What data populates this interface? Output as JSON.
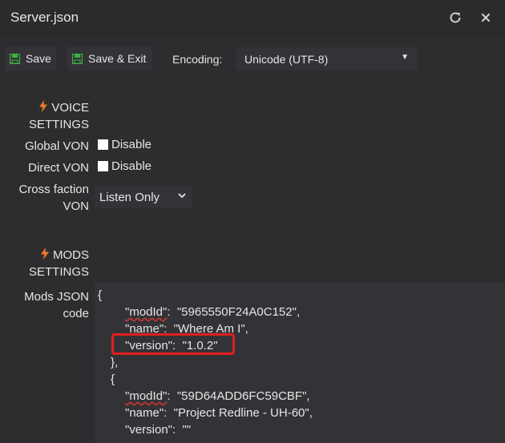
{
  "window": {
    "title": "Server.json"
  },
  "toolbar": {
    "save_label": "Save",
    "save_exit_label": "Save & Exit",
    "encoding_label": "Encoding:",
    "encoding_value": "Unicode (UTF-8)"
  },
  "voice": {
    "section_line1": "VOICE",
    "section_line2": "SETTINGS",
    "global_von_label": "Global VON",
    "global_von_option": "Disable",
    "direct_von_label": "Direct VON",
    "direct_von_option": "Disable",
    "cross_faction_line1": "Cross faction",
    "cross_faction_line2": "VON",
    "cross_faction_value": "Listen Only"
  },
  "mods": {
    "section_line1": "MODS",
    "section_line2": "SETTINGS",
    "json_label_line1": "Mods JSON",
    "json_label_line2": "code",
    "code": {
      "l1": "{",
      "mod1_key_id": "\"modId\"",
      "mod1_val_id": ":  \"5965550F24A0C152\",",
      "mod1_name": "\"name\":  \"Where Am I\",",
      "mod1_version": "\"version\":  \"1.0.2\"",
      "l5": "},",
      "l6": "{",
      "mod2_key_id": "\"modId\"",
      "mod2_val_id": ":  \"59D64ADD6FC59CBF\",",
      "mod2_name": "\"name\":  \"Project Redline - UH-60\",",
      "mod2_version": "\"version\":  \"\""
    }
  },
  "colors": {
    "accent_bolt": "#f07a2a",
    "highlight": "#e02020",
    "save_icon": "#3cb043"
  }
}
